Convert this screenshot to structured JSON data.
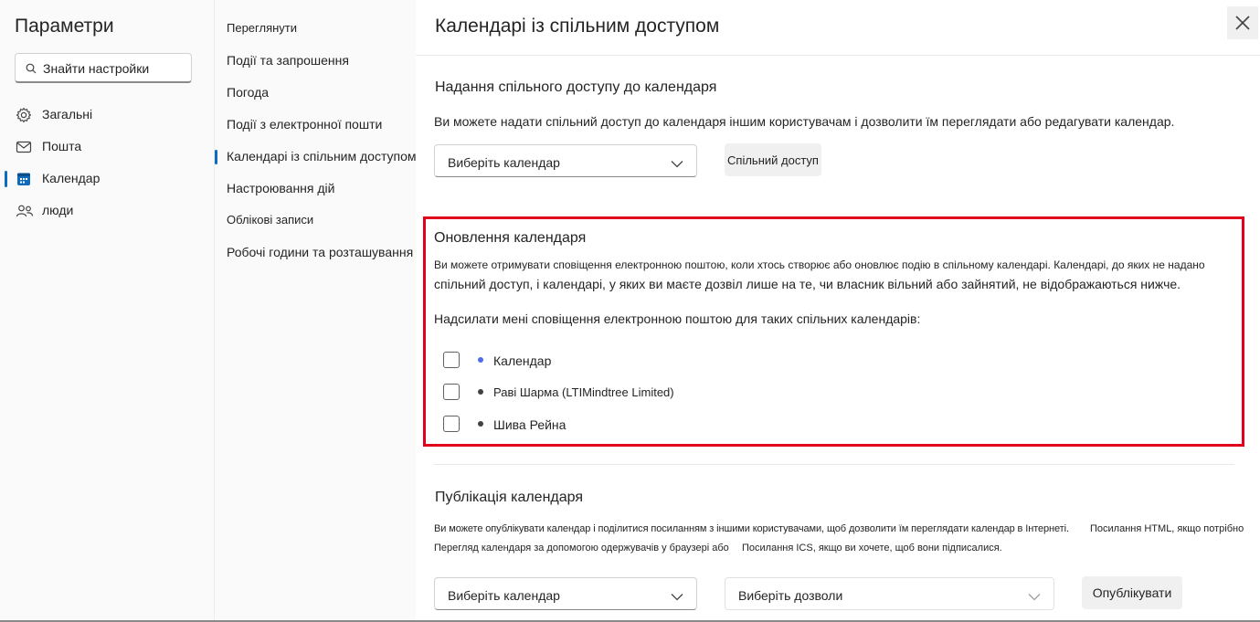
{
  "app": {
    "title": "Параметри"
  },
  "search": {
    "placeholder": "Знайти настройки"
  },
  "nav": {
    "items": [
      {
        "label": "Загальні",
        "icon": "gear-icon"
      },
      {
        "label": "Пошта",
        "icon": "mail-icon"
      },
      {
        "label": "Календар",
        "icon": "calendar-icon",
        "active": true
      },
      {
        "label": "люди",
        "icon": "people-icon"
      }
    ]
  },
  "subnav": {
    "items": [
      {
        "label": "Переглянути"
      },
      {
        "label": "Події та запрошення"
      },
      {
        "label": "Погода"
      },
      {
        "label": "Події з електронної пошти"
      },
      {
        "label": "Календарі із спільним доступом",
        "active": true
      },
      {
        "label": "Настроювання дій"
      },
      {
        "label": "Облікові записи"
      },
      {
        "label": "Робочі години та розташування"
      }
    ]
  },
  "panel": {
    "title": "Календарі із спільним доступом"
  },
  "sharing": {
    "title": "Надання спільного доступу до календаря",
    "description": "Ви можете надати спільний доступ до календаря іншим користувачам і дозволити їм переглядати або редагувати календар.",
    "select_calendar": "Виберіть календар",
    "share_button": "Спільний доступ"
  },
  "updates": {
    "title": "Оновлення календаря",
    "description_line1": "Ви можете отримувати сповіщення електронною поштою, коли хтось створює або оновлює подію в спільному календарі. Календарі, до яких не надано",
    "description_line2": "спільний доступ, і календарі, у яких ви маєте дозвіл лише на те, чи власник вільний або зайнятий, не відображаються нижче.",
    "prompt": "Надсилати мені сповіщення електронною поштою для таких спільних календарів:",
    "calendars": [
      {
        "label": "Календар",
        "color": "#4f6bed"
      },
      {
        "label": "Раві Шарма (LTIMindtree Limited)",
        "color": "#424242"
      },
      {
        "label": "Шива Рейна",
        "color": "#424242"
      }
    ]
  },
  "publish": {
    "title": "Публікація календаря",
    "line1a": "Ви можете опублікувати календар і поділитися посиланням з іншими користувачами, щоб дозволити їм переглядати календар в Інтернеті.",
    "line1b": "Посилання HTML, якщо потрібно",
    "line2a": "Перегляд календаря за допомогою одержувачів у браузері або",
    "line2b": "Посилання ICS, якщо ви хочете, щоб вони підписалися.",
    "select_calendar": "Виберіть календар",
    "select_permissions": "Виберіть дозволи",
    "publish_button": "Опублікувати"
  },
  "colors": {
    "accent": "#0f6cbd",
    "highlight": "#e3001b"
  }
}
